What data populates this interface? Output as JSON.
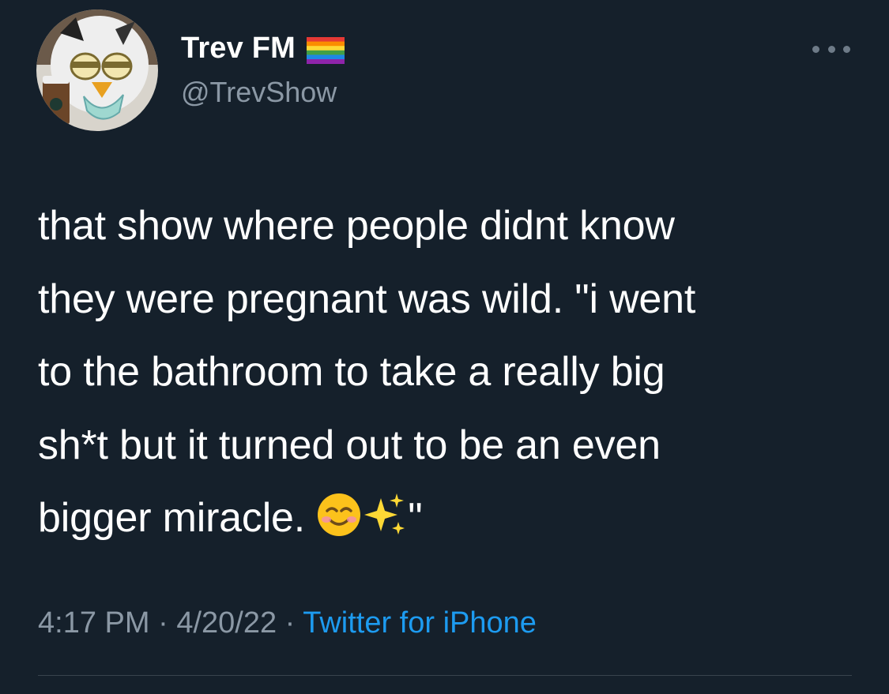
{
  "author": {
    "display_name": "Trev FM",
    "handle": "@TrevShow",
    "avatar_icon": "furby-avatar-icon",
    "flag_icon": "rainbow-flag-icon"
  },
  "menu": {
    "more_icon": "more-options-icon"
  },
  "tweet": {
    "text_part1": "that show where people didnt know\nthey were pregnant was wild. \"i went\nto the bathroom to take a really big\nsh*t but it turned out to be an even\nbigger miracle. ",
    "text_part2": "\"",
    "emojis": [
      "smiling-face-icon",
      "sparkles-icon"
    ]
  },
  "meta": {
    "time": "4:17 PM",
    "separator1": " · ",
    "date": "4/20/22",
    "separator2": " · ",
    "source": "Twitter for iPhone"
  },
  "colors": {
    "background": "#15202b",
    "text": "#ffffff",
    "secondary": "#8b98a5",
    "link": "#1d9bf0",
    "divider": "#38444d"
  }
}
